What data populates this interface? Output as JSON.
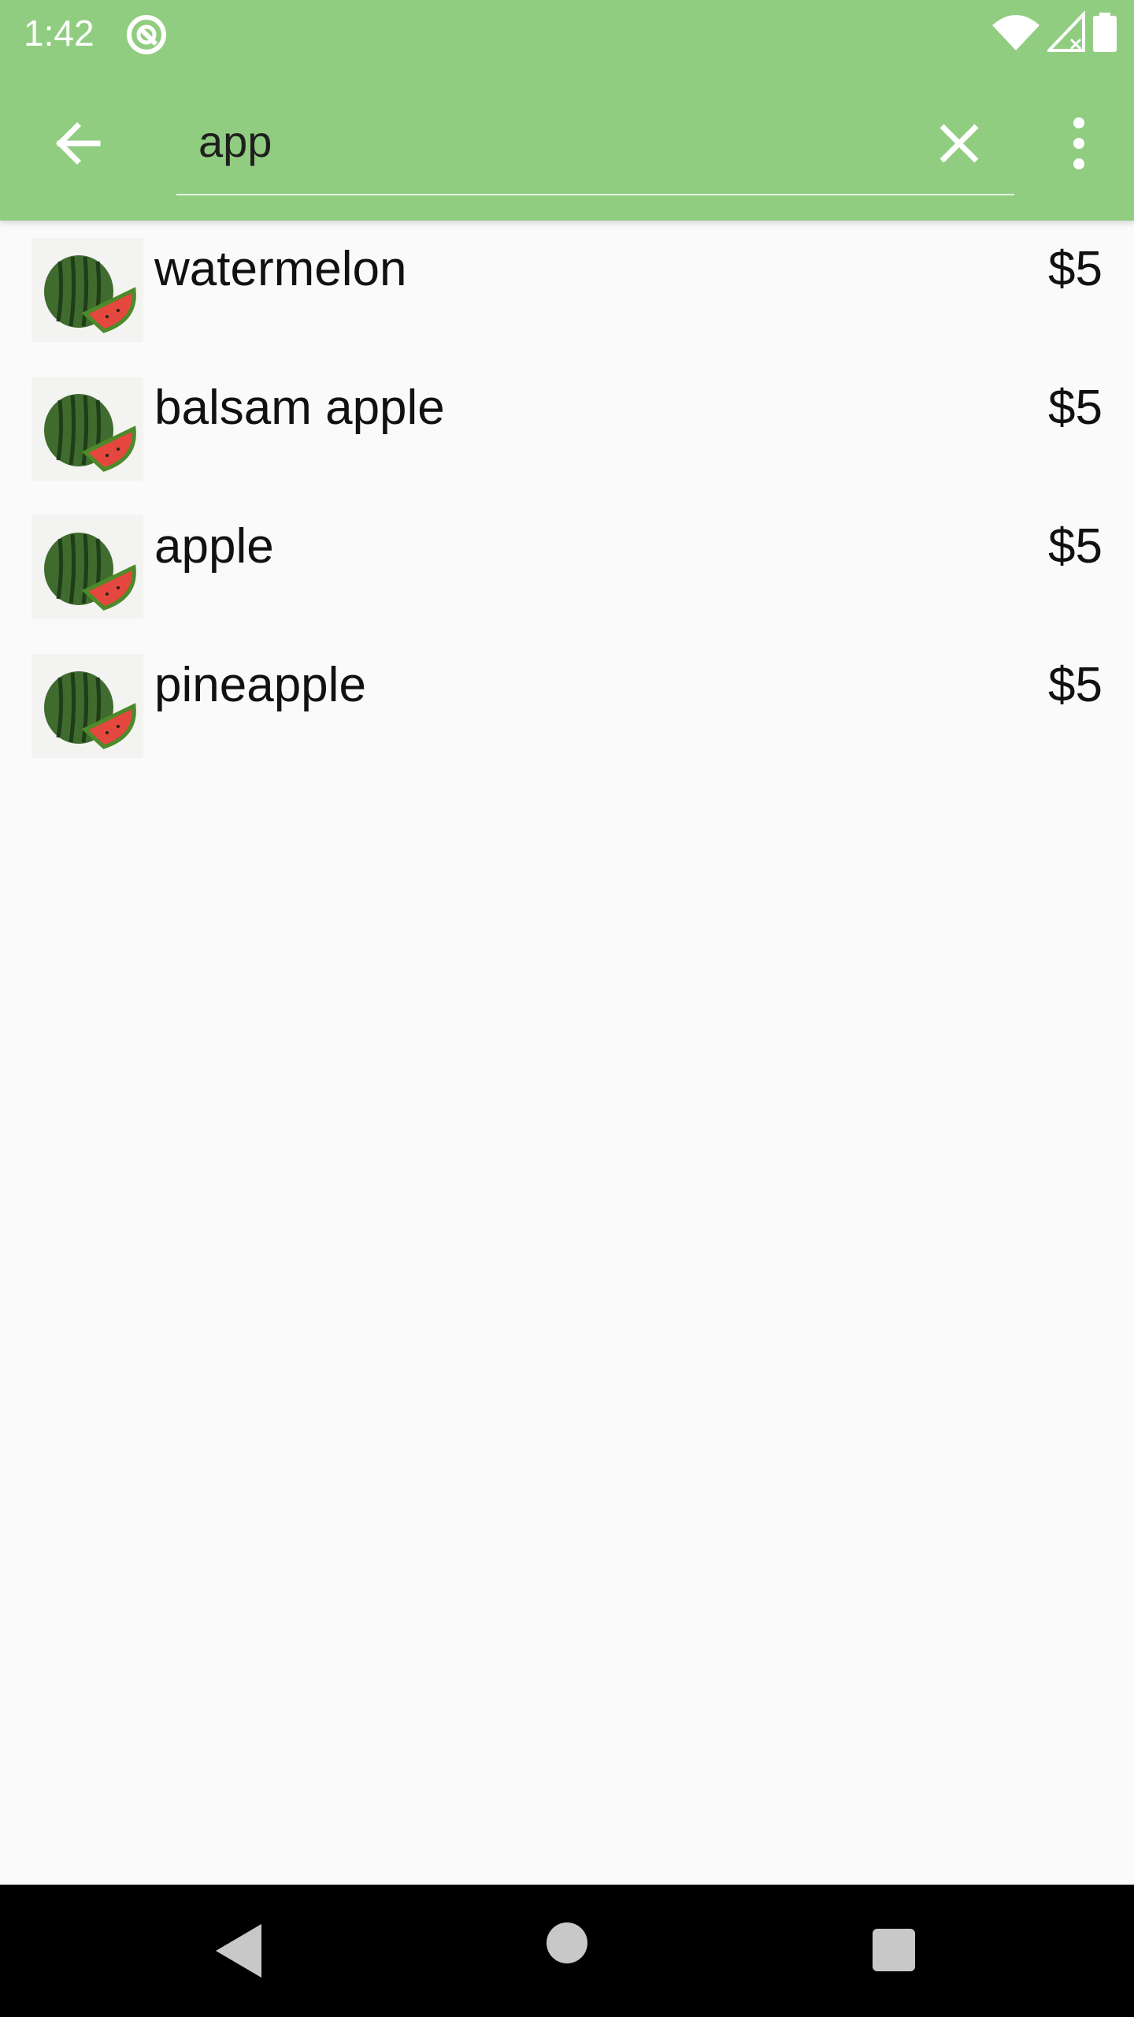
{
  "status_bar": {
    "time": "1:42",
    "app_icon": "sync-circle-icon",
    "wifi_icon": "wifi-icon",
    "signal_icon": "signal-no-service-icon",
    "battery_icon": "battery-full-icon",
    "background_color": "#91cd81"
  },
  "app_bar": {
    "back_icon": "arrow-back-icon",
    "search_value": "app",
    "clear_icon": "close-icon",
    "overflow_icon": "more-vert-icon",
    "background_color": "#91cd81"
  },
  "results": [
    {
      "name": "watermelon",
      "price": "$5",
      "thumbnail": "watermelon-image"
    },
    {
      "name": "balsam apple",
      "price": "$5",
      "thumbnail": "watermelon-image"
    },
    {
      "name": "apple",
      "price": "$5",
      "thumbnail": "watermelon-image"
    },
    {
      "name": "pineapple",
      "price": "$5",
      "thumbnail": "watermelon-image"
    }
  ],
  "nav_bar": {
    "back_icon": "nav-back-triangle-icon",
    "home_icon": "nav-home-circle-icon",
    "recents_icon": "nav-recents-square-icon"
  }
}
